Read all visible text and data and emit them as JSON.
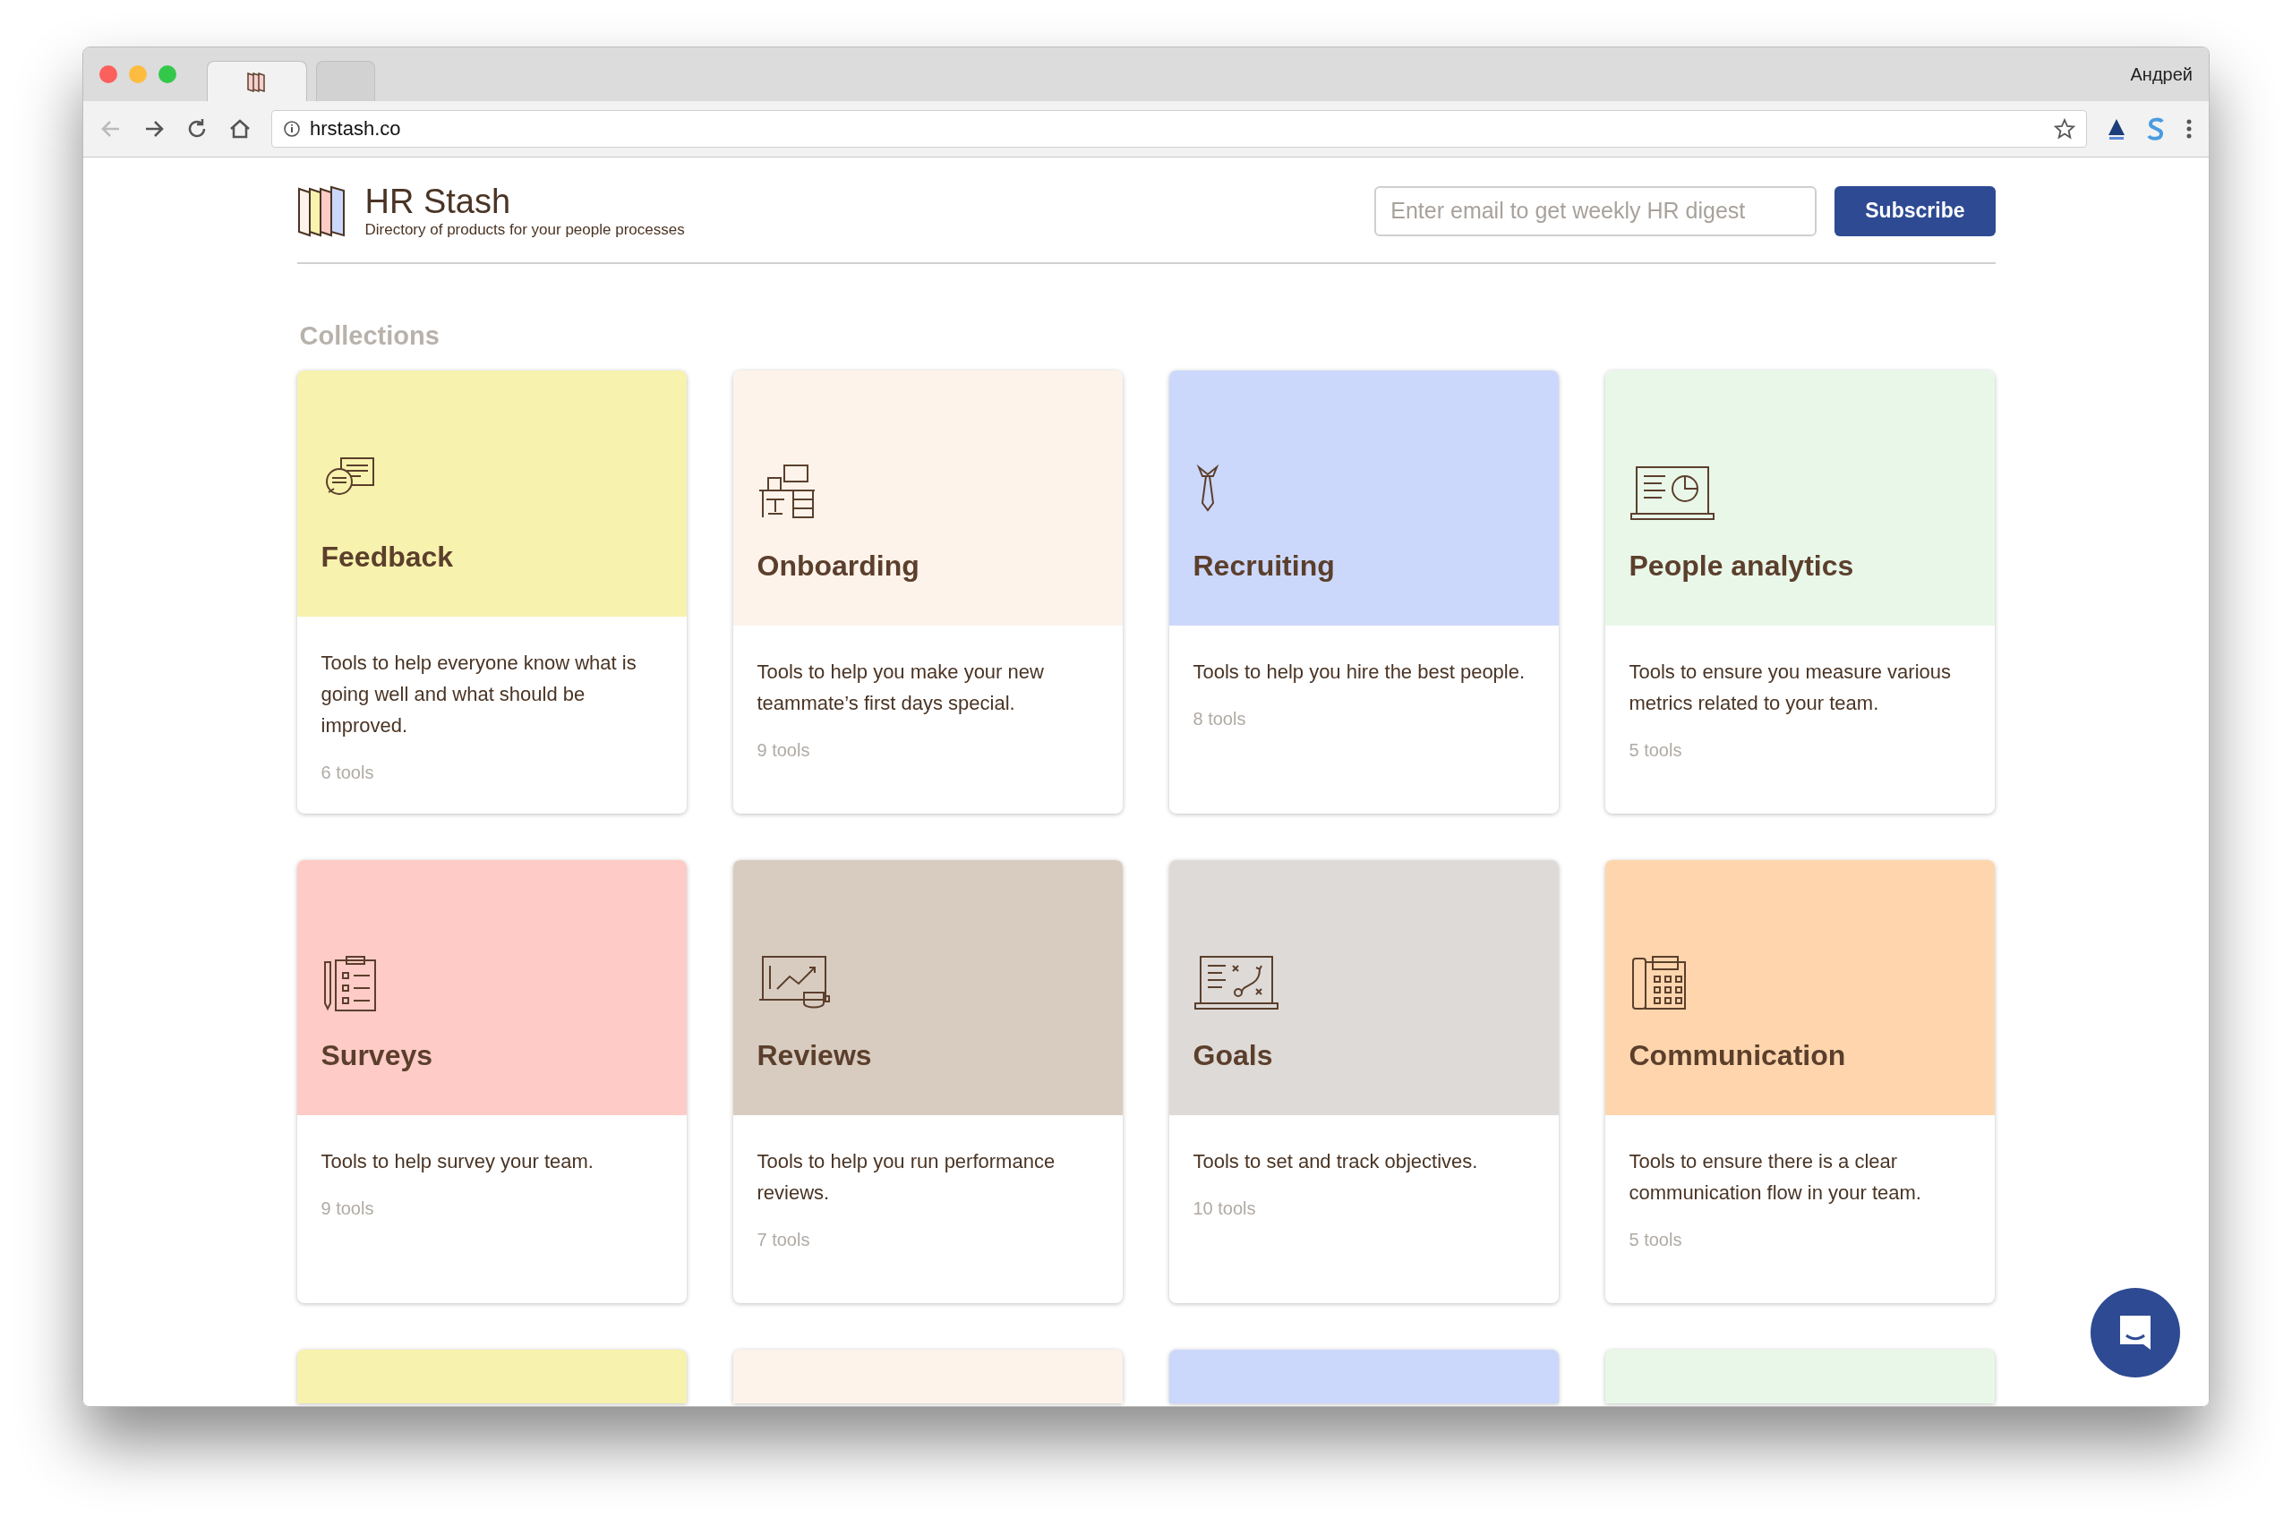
{
  "browser": {
    "tabs": [
      {
        "selected": true
      },
      {
        "selected": false
      }
    ],
    "user_name": "Андрей",
    "url": "hrstash.co"
  },
  "header": {
    "title": "HR Stash",
    "tagline": "Directory of products for your people processes",
    "email": {
      "placeholder": "Enter email to get weekly HR digest"
    },
    "subscribe": "Subscribe"
  },
  "section_title": "Collections",
  "collections": [
    {
      "title": "Feedback",
      "description": "Tools to help everyone know what is going well and what should be improved.",
      "count": "6 tools",
      "color": "#f7f2ad"
    },
    {
      "title": "Onboarding",
      "description": "Tools to help you make your new teammate’s first days special.",
      "count": "9 tools",
      "color": "#fdf3ea"
    },
    {
      "title": "Recruiting",
      "description": "Tools to help you hire the best people.",
      "count": "8 tools",
      "color": "#ccd8fb"
    },
    {
      "title": "People analytics",
      "description": "Tools to ensure you measure various metrics related to your team.",
      "count": "5 tools",
      "color": "#e9f7e9"
    },
    {
      "title": "Surveys",
      "description": "Tools to help survey your team.",
      "count": "9 tools",
      "color": "#fecbc6"
    },
    {
      "title": "Reviews",
      "description": "Tools to help you run performance reviews.",
      "count": "7 tools",
      "color": "#d8ccc0"
    },
    {
      "title": "Goals",
      "description": "Tools to set and track objectives.",
      "count": "10 tools",
      "color": "#dedad7"
    },
    {
      "title": "Communication",
      "description": "Tools to ensure there is a clear communication flow in your team.",
      "count": "5 tools",
      "color": "#fed5ad"
    }
  ],
  "more_collections": [
    {
      "color": "#f7f2ad"
    },
    {
      "color": "#fdf3ea"
    },
    {
      "color": "#ccd8fb"
    },
    {
      "color": "#e9f7e9"
    }
  ]
}
